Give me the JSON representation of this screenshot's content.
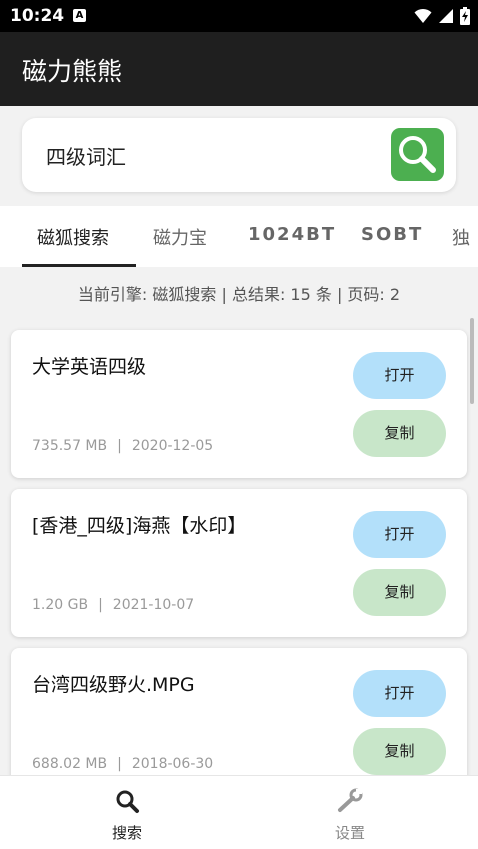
{
  "status_bar": {
    "time": "10:24",
    "notification_icon": "A"
  },
  "app": {
    "title": "磁力熊熊"
  },
  "search": {
    "value": "四级词汇"
  },
  "tabs": [
    {
      "label": "磁狐搜索"
    },
    {
      "label": "磁力宝"
    },
    {
      "label": "1024BT"
    },
    {
      "label": "SOBT"
    },
    {
      "label": "独"
    }
  ],
  "summary": "当前引擎: 磁狐搜索 | 总结果: 15 条 | 页码: 2",
  "results": [
    {
      "name": "大学英语四级",
      "size": "735.57 MB",
      "sep": "|",
      "date": "2020-12-05",
      "open_label": "打开",
      "copy_label": "复制"
    },
    {
      "name": "[香港_四级]海燕【水印】",
      "size": "1.20 GB",
      "sep": "|",
      "date": "2021-10-07",
      "open_label": "打开",
      "copy_label": "复制"
    },
    {
      "name": "台湾四级野火.MPG",
      "size": "688.02 MB",
      "sep": "|",
      "date": "2018-06-30",
      "open_label": "打开",
      "copy_label": "复制"
    }
  ],
  "bottom_nav": [
    {
      "label": "搜索",
      "icon": "search-icon",
      "active": true
    },
    {
      "label": "设置",
      "icon": "wrench-icon",
      "active": false
    }
  ],
  "colors": {
    "app_bar": "#1f1f1f",
    "search_button": "#4caf50",
    "open_button": "#b3e0fa",
    "copy_button": "#c8e6c9"
  }
}
